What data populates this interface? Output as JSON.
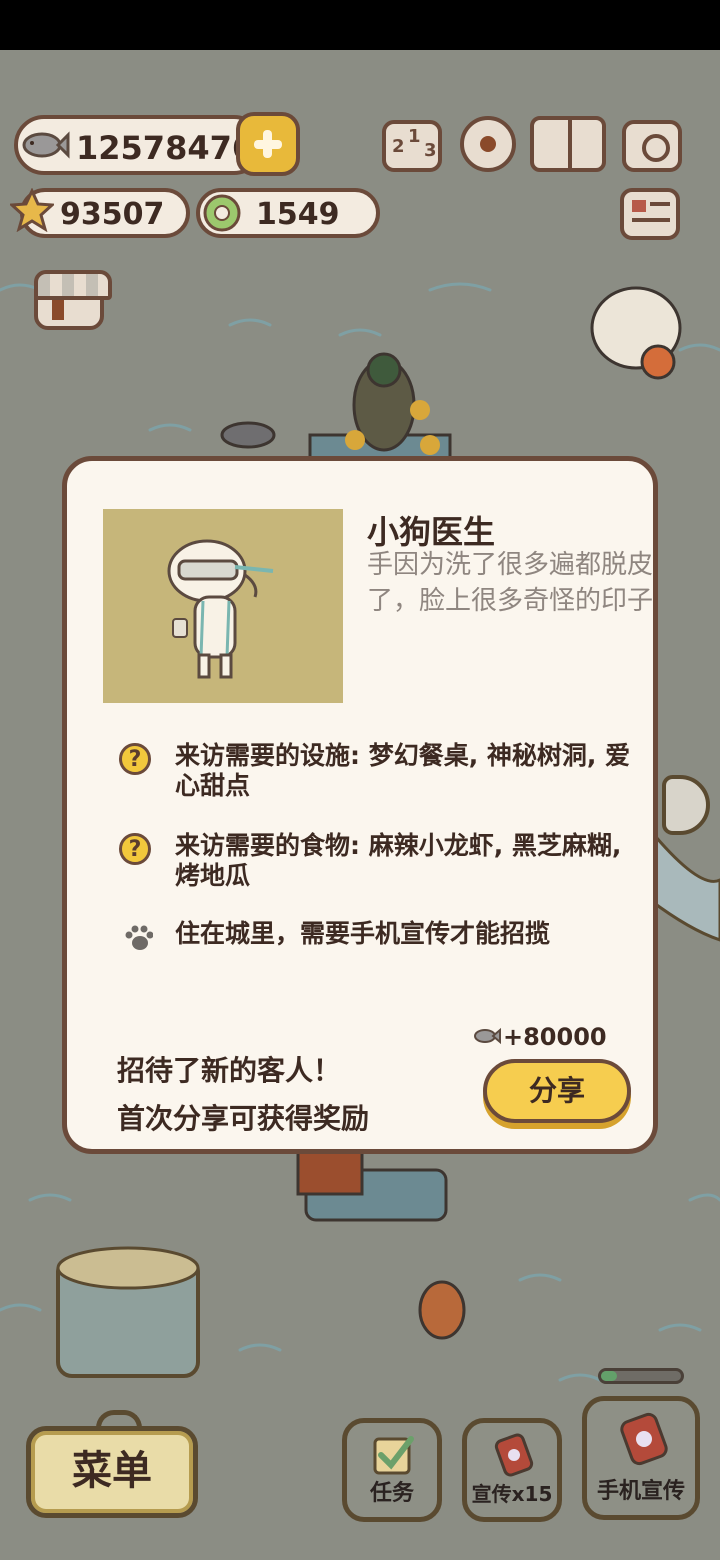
{
  "hud": {
    "fish_count": "12578476",
    "star_count": "93507",
    "ring_count": "1549",
    "icons": [
      "fish-icon",
      "plus-icon",
      "star-icon",
      "clover-icon",
      "ranking-icon",
      "settings-gear-icon",
      "guest-book-icon",
      "camera-icon",
      "newspaper-icon",
      "shop-house-icon"
    ]
  },
  "modal": {
    "name": "小狗医生",
    "description": "手因为洗了很多遍都脱皮了，脸上很多奇怪的印子",
    "requirements": [
      {
        "icon": "question-icon",
        "text": "来访需要的设施: 梦幻餐桌, 神秘树洞, 爱心甜点"
      },
      {
        "icon": "question-icon",
        "text": "来访需要的食物: 麻辣小龙虾, 黑芝麻糊, 烤地瓜"
      },
      {
        "icon": "paw-icon",
        "text": "住在城里，需要手机宣传才能招揽"
      }
    ],
    "reward": "+80000",
    "share_message_line1": "招待了新的客人！",
    "share_message_line2": "首次分享可获得奖励",
    "share_button": "分享"
  },
  "bottom": {
    "menu": "菜单",
    "task": "任务",
    "promo": "宣传x15",
    "phone_promo": "手机宣传",
    "progress_fraction": 0.2
  },
  "colors": {
    "accent_yellow": "#f6cd4f",
    "outline_brown": "#6b4a3a",
    "panel_cream": "#fbf6ee"
  }
}
